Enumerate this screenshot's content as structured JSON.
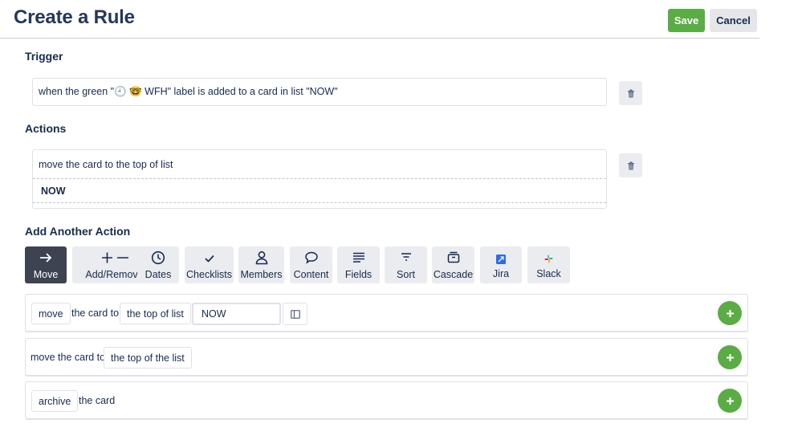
{
  "header": {
    "title": "Create a Rule",
    "save_label": "Save",
    "cancel_label": "Cancel"
  },
  "trigger": {
    "heading": "Trigger",
    "text": "when the green \"🕘 🤓 WFH\" label is added to a card in list \"NOW\""
  },
  "actions": {
    "heading": "Actions",
    "action_text": "move the card to the top of list",
    "list_name": "NOW"
  },
  "add_action": {
    "heading": "Add Another Action",
    "tabs": [
      {
        "label": "Move",
        "icon": "arrow-right-icon",
        "active": true
      },
      {
        "label": "Add/Remove",
        "icon": "plus-minus-icon"
      },
      {
        "label": "Dates",
        "icon": "clock-icon"
      },
      {
        "label": "Checklists",
        "icon": "checkmark-icon"
      },
      {
        "label": "Members",
        "icon": "person-icon"
      },
      {
        "label": "Content",
        "icon": "speech-bubble-icon"
      },
      {
        "label": "Fields",
        "icon": "lines-icon"
      },
      {
        "label": "Sort",
        "icon": "filter-icon"
      },
      {
        "label": "Cascade",
        "icon": "archive-box-icon"
      },
      {
        "label": "Jira",
        "icon": "jira-icon"
      },
      {
        "label": "Slack",
        "icon": "slack-icon"
      }
    ]
  },
  "cards": [
    {
      "verb": "move",
      "text": "the card to",
      "position": "the top of list",
      "list_value": "NOW"
    },
    {
      "text": "move the card to",
      "position": "the top of the list"
    },
    {
      "verb": "archive",
      "text": "the card"
    }
  ],
  "colors": {
    "save": "#5aac44",
    "cancel": "#e4e6ea",
    "active_tab": "#3d4351",
    "tab": "#ebecf0",
    "jira": "#2e6be6"
  }
}
